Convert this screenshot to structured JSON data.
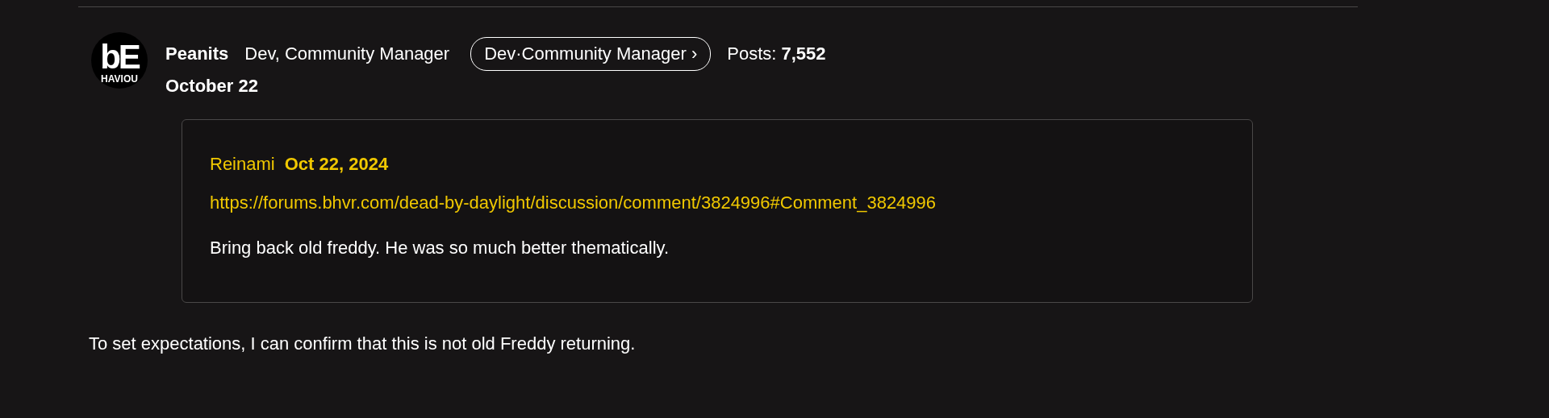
{
  "post": {
    "avatar": {
      "logo_text": "bE",
      "logo_subtext": "HAVIOU"
    },
    "author": "Peanits",
    "title": "Dev, Community Manager",
    "role_badge": "Dev·Community Manager ›",
    "posts_label": "Posts:",
    "posts_count": "7,552",
    "date": "October 22",
    "quote": {
      "author": "Reinami",
      "date": "Oct 22, 2024",
      "link": "https://forums.bhvr.com/dead-by-daylight/discussion/comment/3824996#Comment_3824996",
      "body": "Bring back old freddy. He was so much better thematically."
    },
    "body": "To set expectations, I can confirm that this is not old Freddy returning."
  }
}
